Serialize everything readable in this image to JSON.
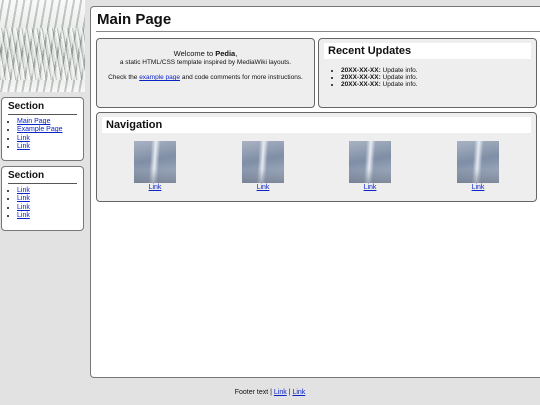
{
  "page_title": "Main Page",
  "sidebar": [
    {
      "heading": "Section",
      "links": [
        "Main Page",
        "Example Page",
        "Link",
        "Link"
      ]
    },
    {
      "heading": "Section",
      "links": [
        "Link",
        "Link",
        "Link",
        "Link"
      ]
    }
  ],
  "welcome": {
    "prefix": "Welcome to ",
    "site_name": "Pedia",
    "suffix": ",",
    "tagline": "a static HTML/CSS template inspired by MediaWiki layouts.",
    "check_prefix": "Check the ",
    "example_link": "example page",
    "check_suffix": " and code comments for more instructions."
  },
  "updates": {
    "title": "Recent Updates",
    "items": [
      {
        "date": "20XX-XX-XX:",
        "text": " Update info."
      },
      {
        "date": "20XX-XX-XX:",
        "text": " Update info."
      },
      {
        "date": "20XX-XX-XX:",
        "text": " Update info."
      }
    ]
  },
  "navigation": {
    "title": "Navigation",
    "items": [
      "Link",
      "Link",
      "Link",
      "Link"
    ]
  },
  "footer": {
    "text": "Footer text | ",
    "link1": "Link",
    "sep": " | ",
    "link2": "Link"
  }
}
